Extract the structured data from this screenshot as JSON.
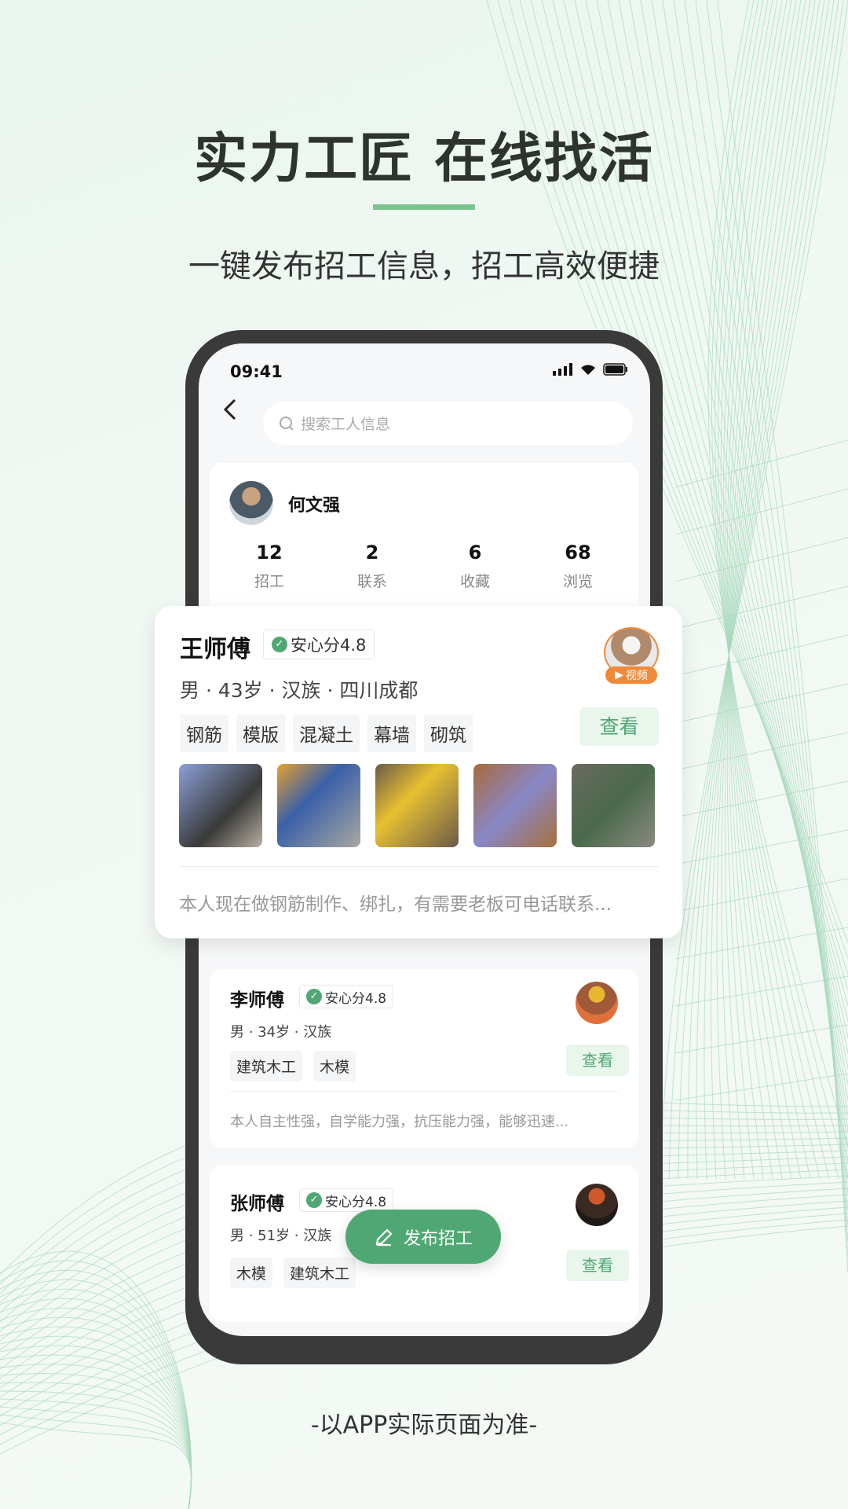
{
  "hero": {
    "title": "实力工匠 在线找活",
    "subtitle": "一键发布招工信息，招工高效便捷",
    "accent": "#7cc48f"
  },
  "status_bar": {
    "time": "09:41"
  },
  "search": {
    "placeholder": "搜索工人信息",
    "icon": "search-icon"
  },
  "profile": {
    "name": "何文强",
    "stats": [
      {
        "value": "12",
        "label": "招工"
      },
      {
        "value": "2",
        "label": "联系"
      },
      {
        "value": "6",
        "label": "收藏"
      },
      {
        "value": "68",
        "label": "浏览"
      }
    ]
  },
  "workers": [
    {
      "name": "王师傅",
      "score": "安心分4.8",
      "info": "男 · 43岁 · 汉族 · 四川成都",
      "tags": [
        "钢筋",
        "模版",
        "混凝土",
        "幕墙",
        "砌筑"
      ],
      "video_label": "视频",
      "view": "查看",
      "desc": "本人现在做钢筋制作、绑扎，有需要老板可电话联系..."
    },
    {
      "name": "李师傅",
      "score": "安心分4.8",
      "info": "男 · 34岁 · 汉族",
      "tags": [
        "建筑木工",
        "木模"
      ],
      "view": "查看",
      "desc": "本人自主性强，自学能力强，抗压能力强，能够迅速..."
    },
    {
      "name": "张师傅",
      "score": "安心分4.8",
      "info": "男 · 51岁 · 汉族",
      "tags": [
        "木模",
        "建筑木工"
      ],
      "view": "查看"
    }
  ],
  "fab": {
    "label": "发布招工",
    "icon": "pencil-icon",
    "color": "#4fa873"
  },
  "footer": {
    "note": "-以APP实际页面为准-"
  }
}
